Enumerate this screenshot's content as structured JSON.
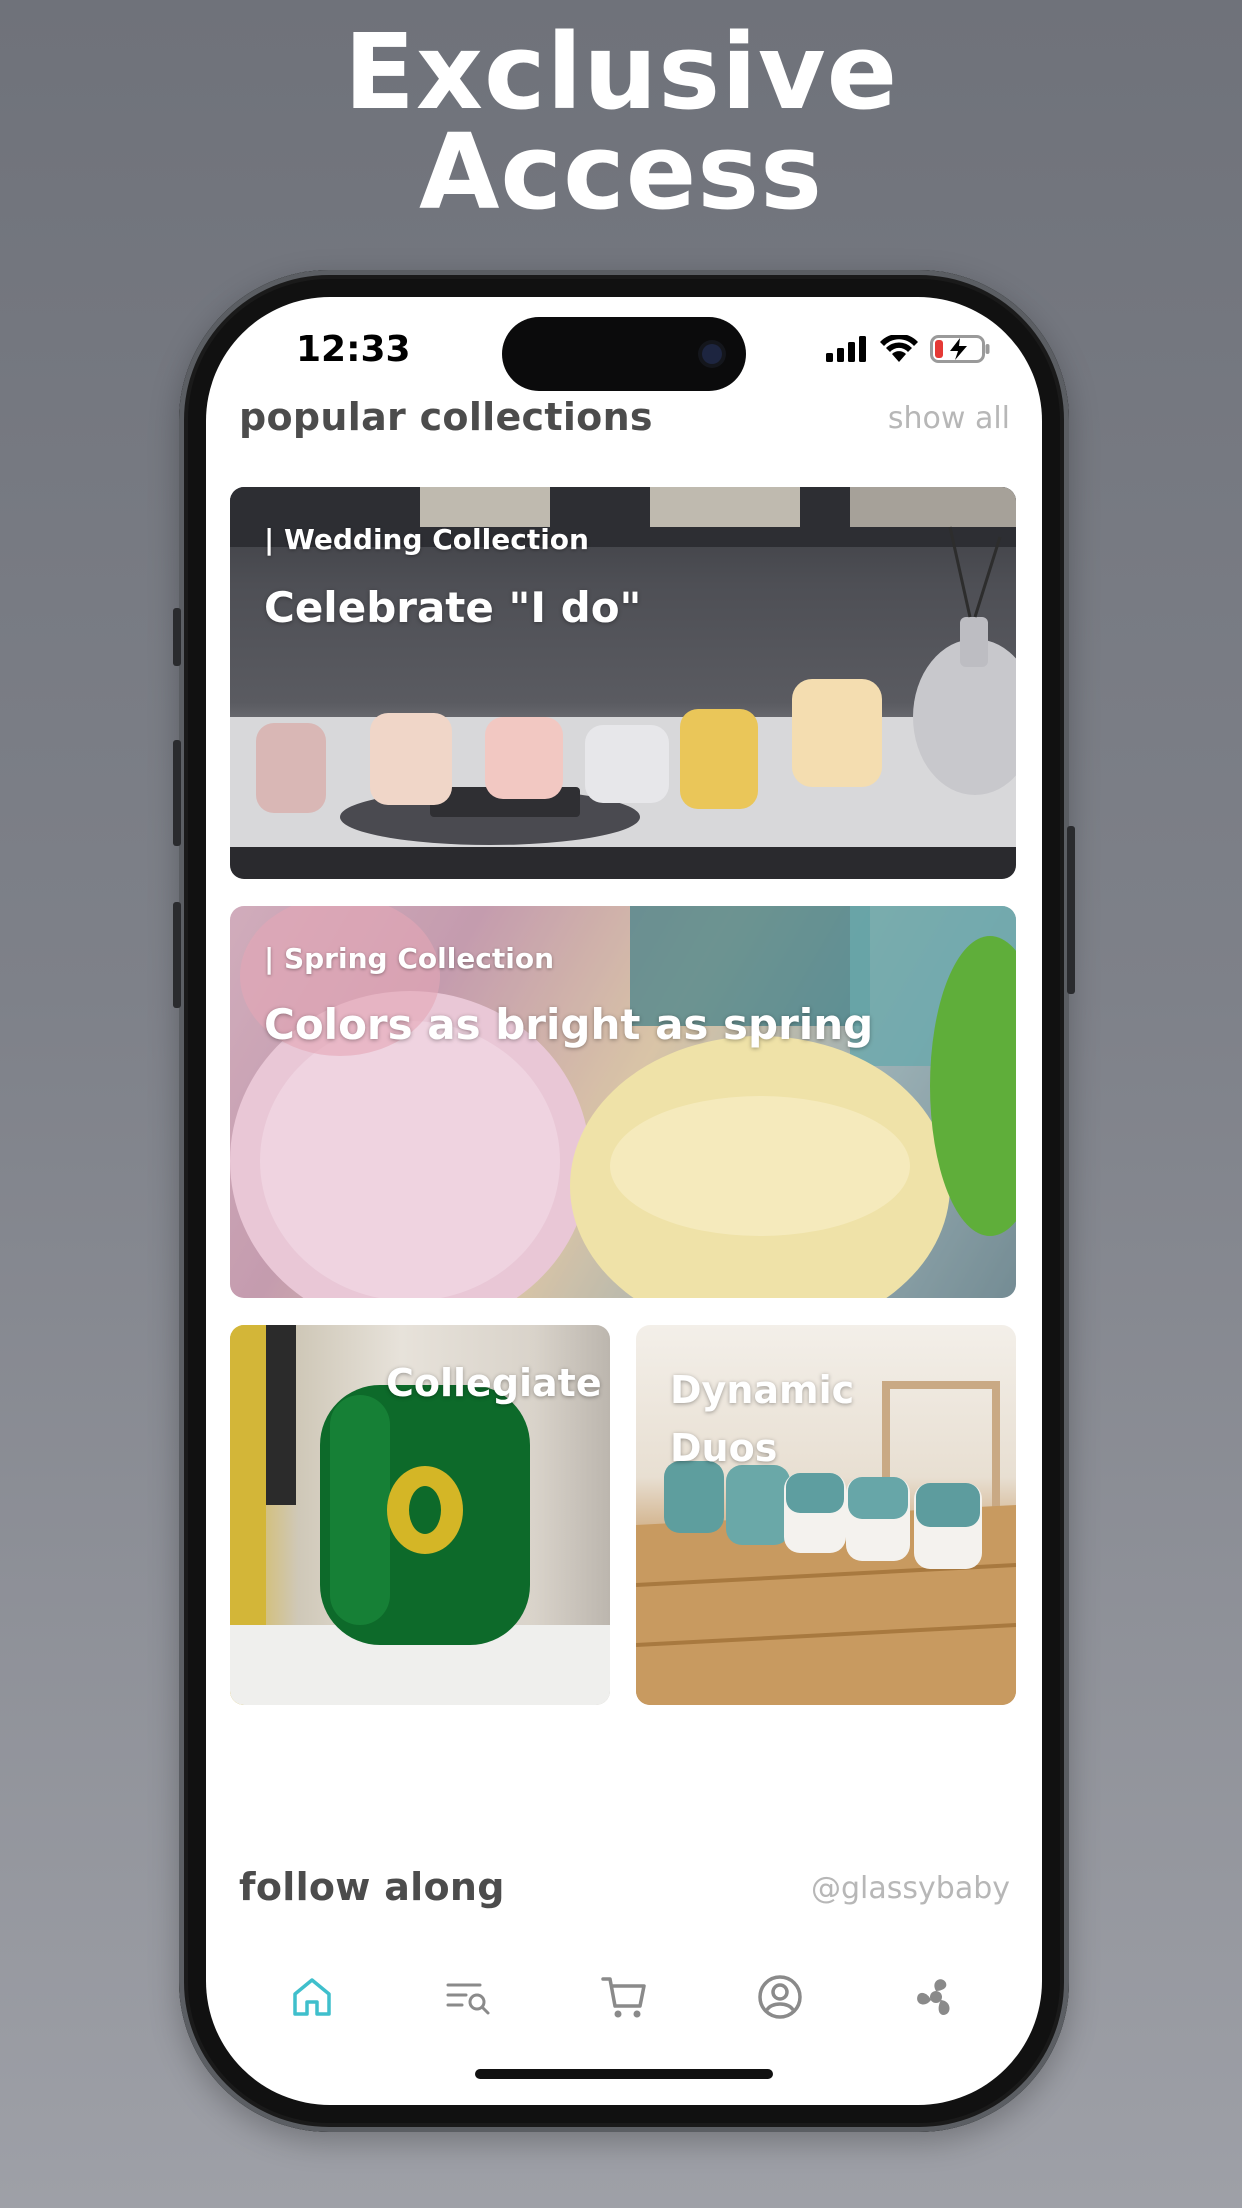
{
  "promo": {
    "headline_line1": "Exclusive",
    "headline_line2": "Access"
  },
  "status_bar": {
    "time": "12:33"
  },
  "popular_collections": {
    "title": "popular collections",
    "show_all_label": "show all",
    "cards": [
      {
        "tag": "| Wedding Collection",
        "headline": "Celebrate \"I do\""
      },
      {
        "tag": "| Spring Collection",
        "headline": "Colors as bright as spring"
      },
      {
        "headline": "Collegiate"
      },
      {
        "headline_line1": "Dynamic",
        "headline_line2": "Duos"
      }
    ]
  },
  "follow_along": {
    "title": "follow along",
    "handle": "@glassybaby"
  },
  "tab_bar": {
    "active_color": "#3fbfcc",
    "inactive_color": "#8a8a8a",
    "icons": [
      "home-icon",
      "search-list-icon",
      "cart-icon",
      "profile-icon",
      "brand-swirl-icon"
    ]
  },
  "battery_color": "#e53935"
}
